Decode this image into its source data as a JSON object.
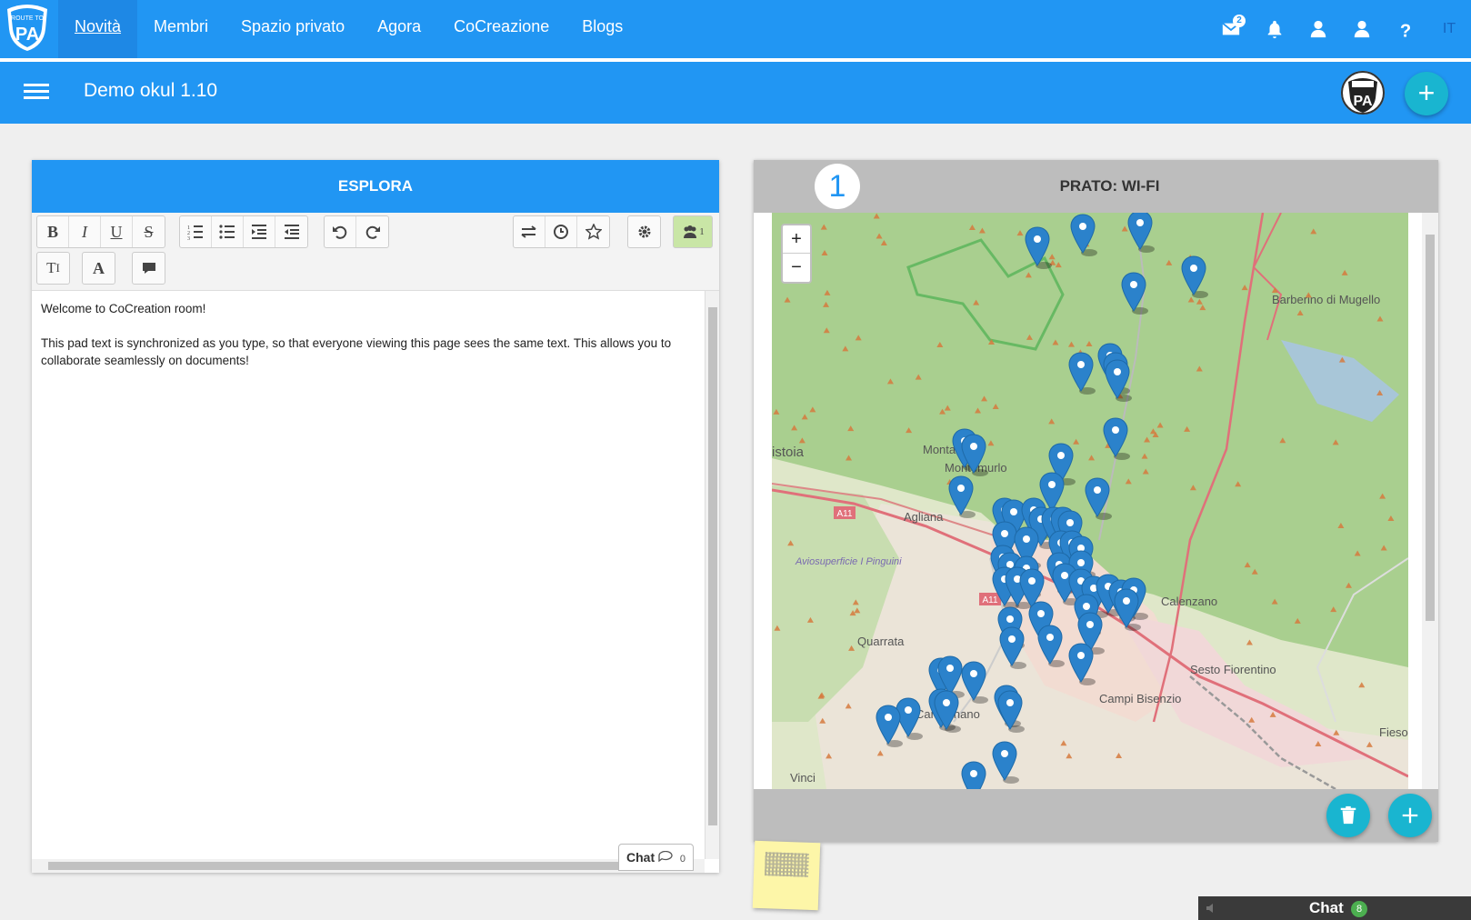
{
  "nav": {
    "logo_top": "ROUTE TO",
    "logo_bottom": "PA",
    "links": [
      {
        "label": "Novità",
        "active": true
      },
      {
        "label": "Membri"
      },
      {
        "label": "Spazio privato"
      },
      {
        "label": "Agora"
      },
      {
        "label": "CoCreazione"
      },
      {
        "label": "Blogs"
      }
    ],
    "icons": [
      "mail-icon",
      "bell-icon",
      "user-icon",
      "user-icon",
      "help-icon"
    ],
    "mail_badge": "2",
    "language": "IT"
  },
  "header": {
    "room_title": "Demo okul 1.10",
    "avatar_logo": "PA",
    "add_label": "+"
  },
  "editor": {
    "title": "ESPLORA",
    "toolbar_icons": [
      "bold-icon",
      "italic-icon",
      "underline-icon",
      "strikethrough-icon",
      "ordered-list-icon",
      "unordered-list-icon",
      "indent-icon",
      "outdent-icon",
      "undo-icon",
      "redo-icon",
      "import-export-icon",
      "timeslider-icon",
      "star-icon",
      "settings-icon",
      "users-icon",
      "text-size-icon",
      "font-color-icon",
      "comment-icon"
    ],
    "users_count": "1",
    "text": {
      "line1": "Welcome to CoCreation room!",
      "line2": "This pad text is synchronized as you type, so that everyone viewing this page sees the same text. This allows you to collaborate seamlessly on documents!"
    },
    "chat_label": "Chat",
    "chat_count": "0"
  },
  "map": {
    "number": "1",
    "title": "PRATO: WI-FI",
    "zoom_in": "+",
    "zoom_out": "−",
    "places": [
      "Barberino di Mugello",
      "istoia",
      "Montale",
      "Montemurlo",
      "Agliana",
      "Aviosuperficie I Pinguini",
      "Quarrata",
      "Calenzano",
      "Sesto Fiorentino",
      "Campi Bisenzio",
      "Carmignano",
      "Fiesol",
      "Vinci",
      "A11",
      "A11"
    ],
    "colors": {
      "land": "#a9cf8f",
      "urban": "#e8e4dc",
      "road": "#e0707a",
      "marker": "#2b82cb"
    }
  },
  "chat_bar": {
    "label": "Chat",
    "count": "8"
  }
}
